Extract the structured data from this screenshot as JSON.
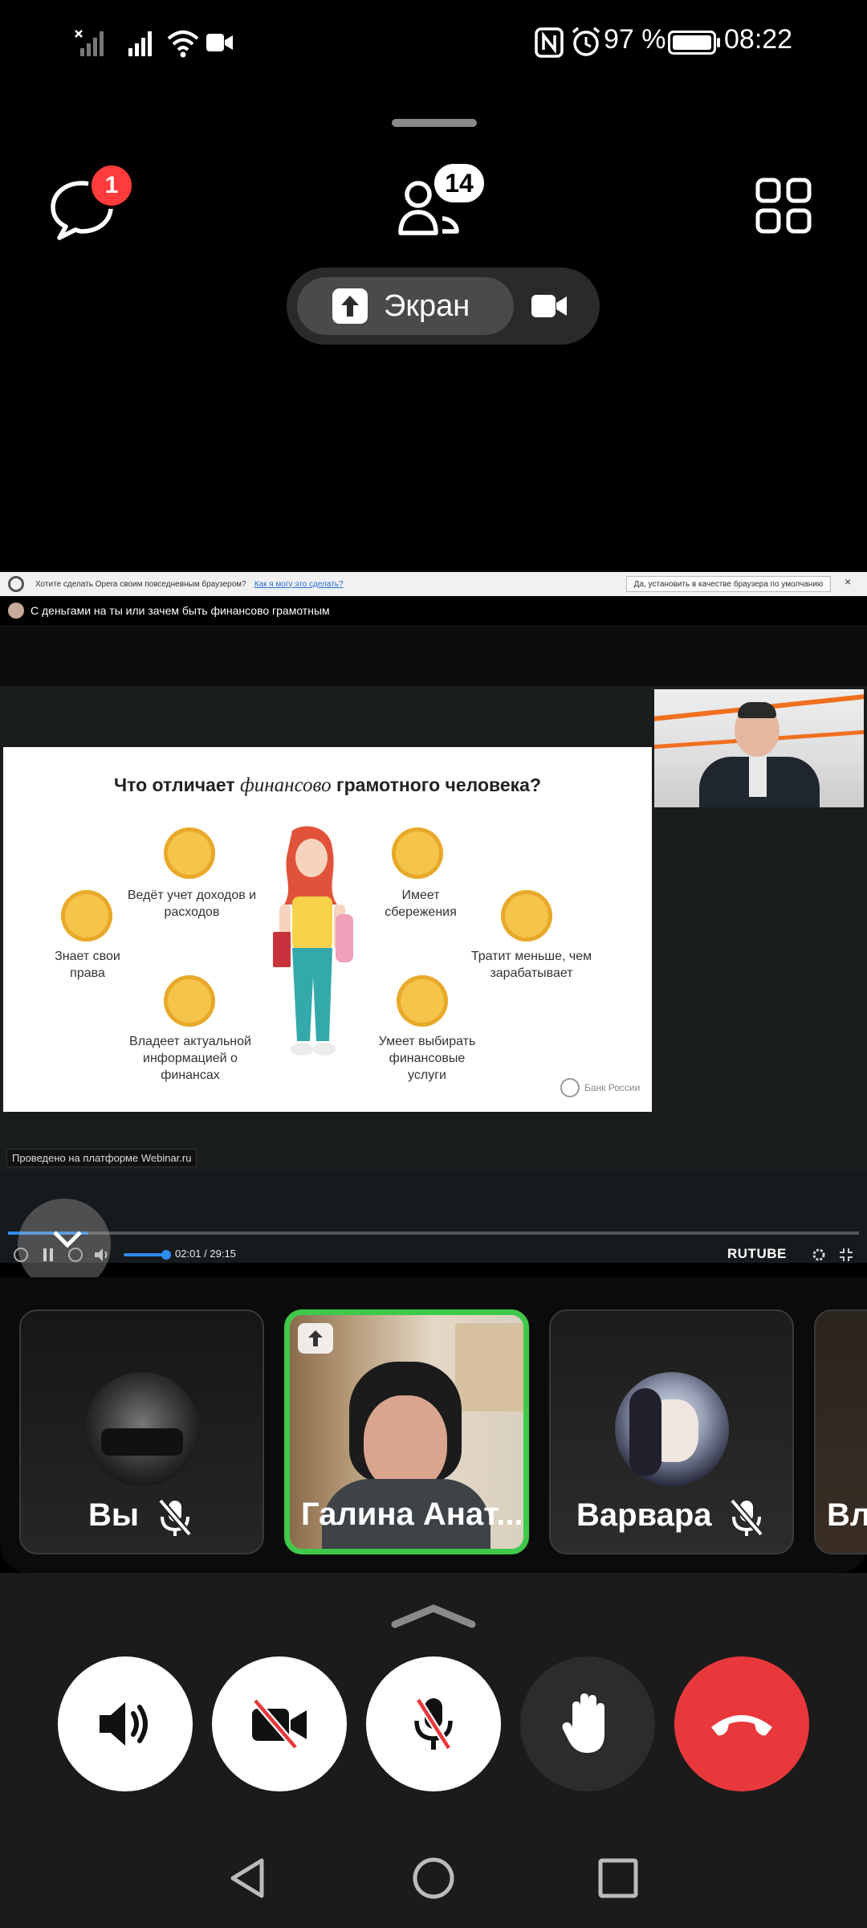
{
  "status_bar": {
    "battery": "97 %",
    "time": "08:22"
  },
  "top": {
    "chat_badge": "1",
    "participants_count": "14",
    "screen_label": "Экран"
  },
  "screen": {
    "opera_prompt": "Хотите сделать Opera своим повседневным браузером?",
    "opera_link": "Как я могу это сделать?",
    "opera_button": "Да, установить в качестве браузера по умолчанию",
    "tab_title": "С деньгами на ты или зачем быть финансово грамотным",
    "slide": {
      "title_pre": "Что отличает ",
      "title_em": "финансово",
      "title_post": " грамотного человека?",
      "items": [
        "Ведёт учет доходов и расходов",
        "Имеет сбережения",
        "Знает свои права",
        "Тратит меньше, чем зарабатывает",
        "Владеет актуальной информацией о финансах",
        "Умеет выбирать финансовые услуги"
      ],
      "logo": "Банк России"
    },
    "platform_tag": "Проведено на платформе Webinar.ru",
    "time": "02:01 / 29:15",
    "rutube": "RUTUBE",
    "progress": 0.07
  },
  "participants": [
    {
      "name": "Вы",
      "muted": true
    },
    {
      "name": "Галина Анат...",
      "speaking": true
    },
    {
      "name": "Варвара",
      "muted": true
    },
    {
      "name": "Вл"
    }
  ],
  "colors": {
    "accent_green": "#3fc94a",
    "badge_red": "#ff3b3b",
    "hangup_red": "#e8383c"
  }
}
